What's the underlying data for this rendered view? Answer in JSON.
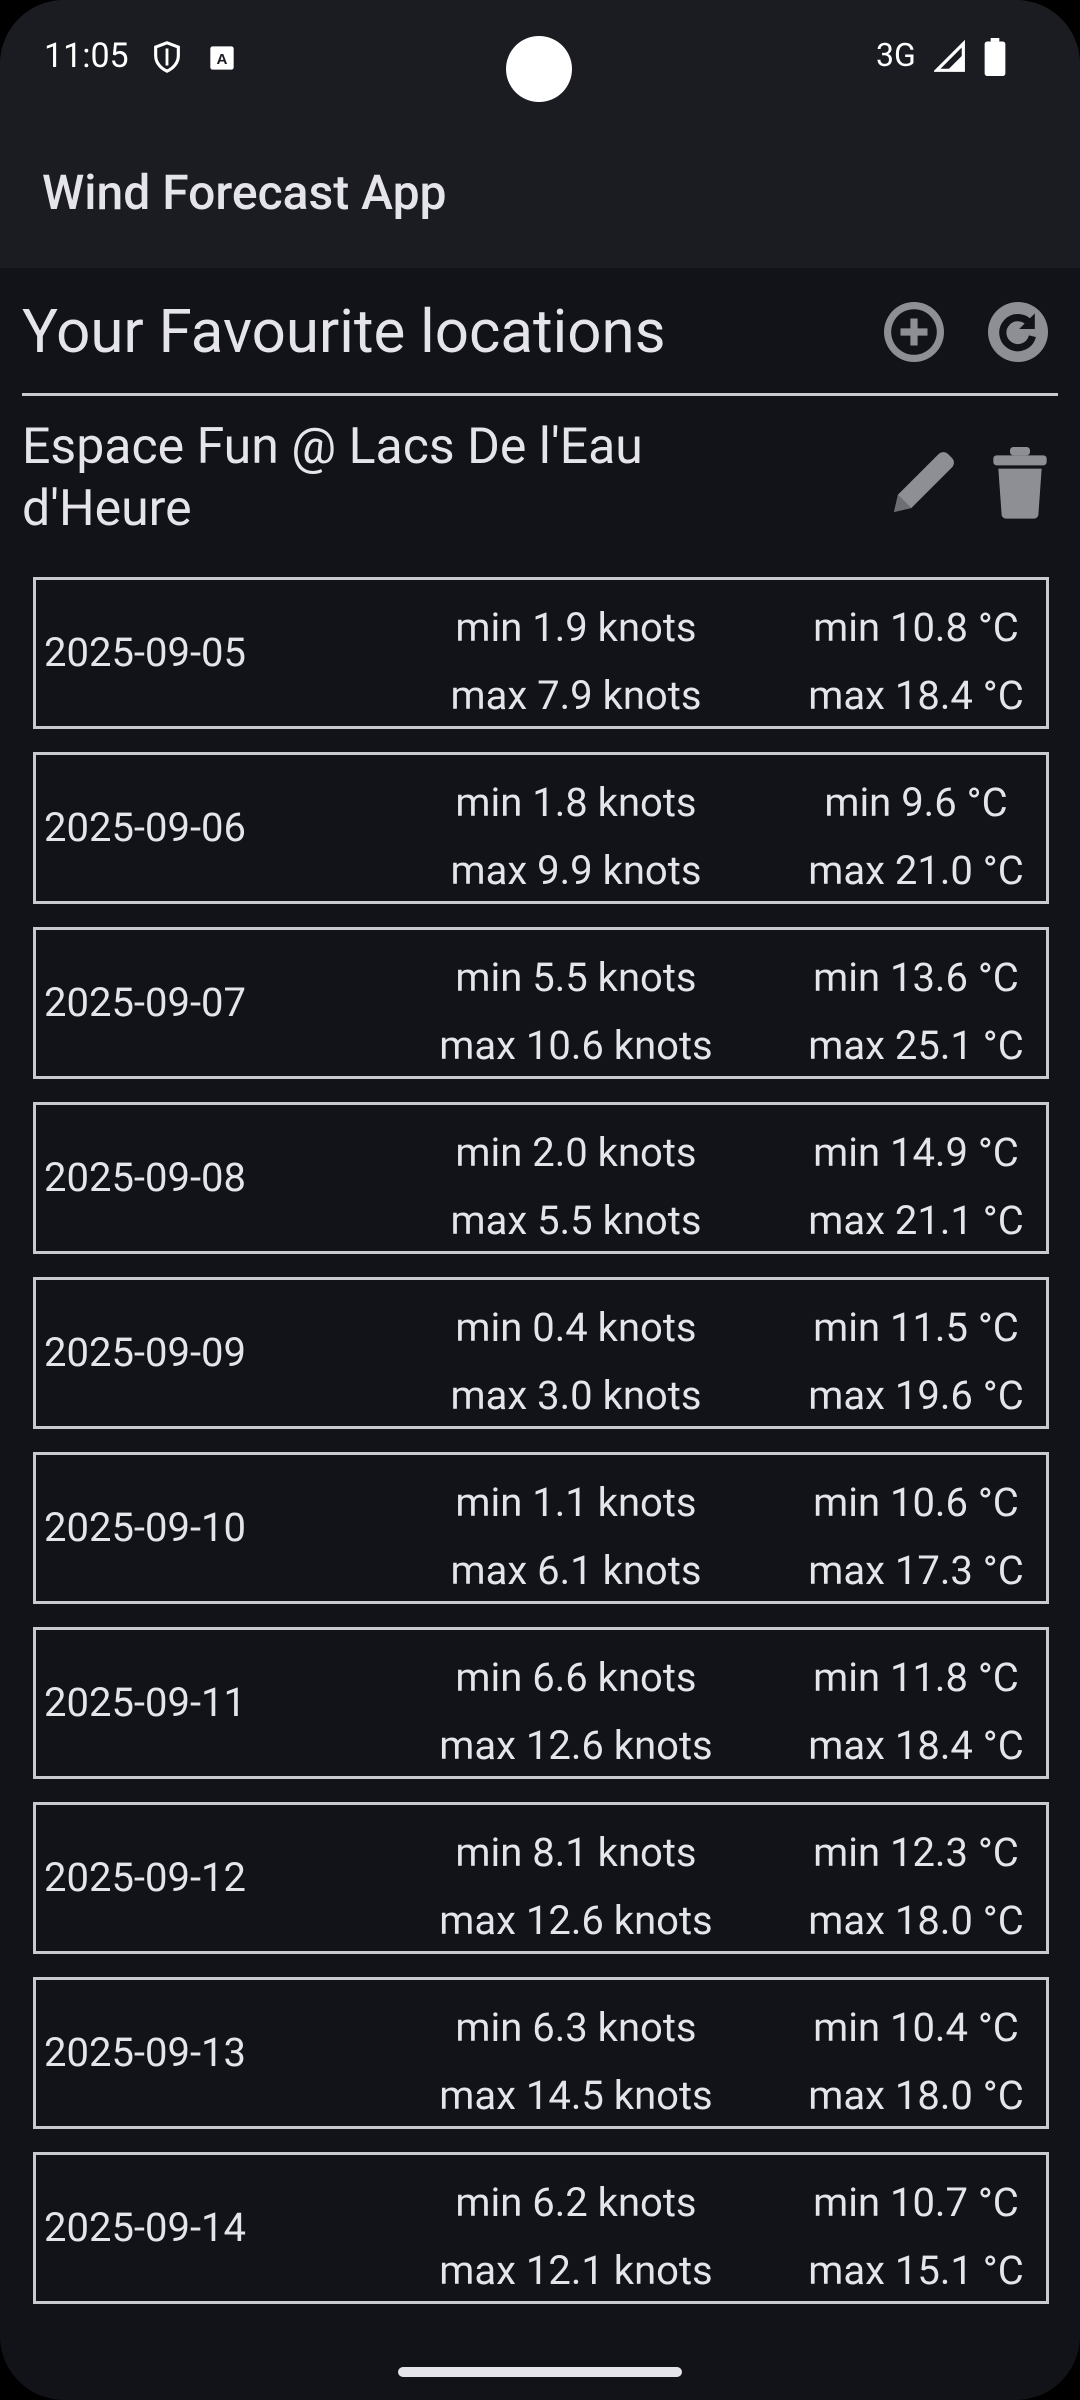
{
  "status_bar": {
    "time": "11:05",
    "network": "3G",
    "icons": [
      "shield-icon",
      "keyboard-a-icon",
      "signal-icon",
      "battery-icon"
    ]
  },
  "app_bar": {
    "title": "Wind Forecast App"
  },
  "favourites": {
    "title": "Your Favourite locations",
    "actions": [
      "add-circle-icon",
      "refresh-icon"
    ]
  },
  "location": {
    "name": "Espace Fun @ Lacs De l'Eau d'Heure",
    "actions": [
      "edit-pencil-icon",
      "delete-trash-icon"
    ]
  },
  "forecast": [
    {
      "date": "2025-09-05",
      "wind_min": "min 1.9 knots",
      "wind_max": "max 7.9 knots",
      "temp_min": "min 10.8 °C",
      "temp_max": "max 18.4 °C"
    },
    {
      "date": "2025-09-06",
      "wind_min": "min 1.8 knots",
      "wind_max": "max 9.9 knots",
      "temp_min": "min 9.6 °C",
      "temp_max": "max 21.0 °C"
    },
    {
      "date": "2025-09-07",
      "wind_min": "min 5.5 knots",
      "wind_max": "max 10.6 knots",
      "temp_min": "min 13.6 °C",
      "temp_max": "max 25.1 °C"
    },
    {
      "date": "2025-09-08",
      "wind_min": "min 2.0 knots",
      "wind_max": "max 5.5 knots",
      "temp_min": "min 14.9 °C",
      "temp_max": "max 21.1 °C"
    },
    {
      "date": "2025-09-09",
      "wind_min": "min 0.4 knots",
      "wind_max": "max 3.0 knots",
      "temp_min": "min 11.5 °C",
      "temp_max": "max 19.6 °C"
    },
    {
      "date": "2025-09-10",
      "wind_min": "min 1.1 knots",
      "wind_max": "max 6.1 knots",
      "temp_min": "min 10.6 °C",
      "temp_max": "max 17.3 °C"
    },
    {
      "date": "2025-09-11",
      "wind_min": "min 6.6 knots",
      "wind_max": "max 12.6 knots",
      "temp_min": "min 11.8 °C",
      "temp_max": "max 18.4 °C"
    },
    {
      "date": "2025-09-12",
      "wind_min": "min 8.1 knots",
      "wind_max": "max 12.6 knots",
      "temp_min": "min 12.3 °C",
      "temp_max": "max 18.0 °C"
    },
    {
      "date": "2025-09-13",
      "wind_min": "min 6.3 knots",
      "wind_max": "max 14.5 knots",
      "temp_min": "min 10.4 °C",
      "temp_max": "max 18.0 °C"
    },
    {
      "date": "2025-09-14",
      "wind_min": "min 6.2 knots",
      "wind_max": "max 12.1 knots",
      "temp_min": "min 10.7 °C",
      "temp_max": "max 15.1 °C"
    }
  ],
  "colors": {
    "background": "#111318",
    "bar": "#1b1c21",
    "text": "#e4e4ea",
    "border": "#c9c9d0",
    "icon": "#8e8f95"
  }
}
